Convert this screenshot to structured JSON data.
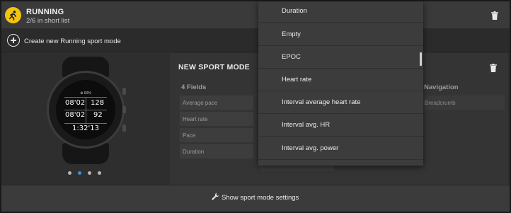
{
  "header": {
    "title": "RUNNING",
    "subtitle": "2/6 in short list"
  },
  "create": {
    "label": "Create new Running sport mode"
  },
  "watch": {
    "top_label": "⊕ 60%",
    "value_top_left": "08'02",
    "value_top_right": "128",
    "value_mid_left": "08'02",
    "value_mid_right": "92",
    "value_bottom": "1:32'13"
  },
  "carousel": {
    "page_count": 4,
    "active_index": 1,
    "active_color": "#3d8fd8"
  },
  "sport_mode": {
    "title": "NEW SPORT MODE",
    "fields_heading": "4 Fields",
    "fields": [
      "Average pace",
      "Heart rate",
      "Pace",
      "Duration"
    ],
    "second_column_value": "Duration",
    "navigation_heading": "Navigation",
    "navigation_value": "Breadcrumb"
  },
  "dropdown": {
    "items": [
      "Duration",
      "Empty",
      "EPOC",
      "Heart rate",
      "Interval average heart rate",
      "Interval avg. HR",
      "Interval avg. power"
    ]
  },
  "footer": {
    "label": "Show sport mode settings"
  },
  "colors": {
    "accent_yellow": "#f2c40f",
    "background": "#2b2b2b",
    "dropdown_bg": "#3c3c3c"
  },
  "icons": {
    "logo": "running-sport-icon",
    "delete": "trash-icon",
    "create": "plus-circle-icon",
    "settings": "wrench-icon"
  }
}
